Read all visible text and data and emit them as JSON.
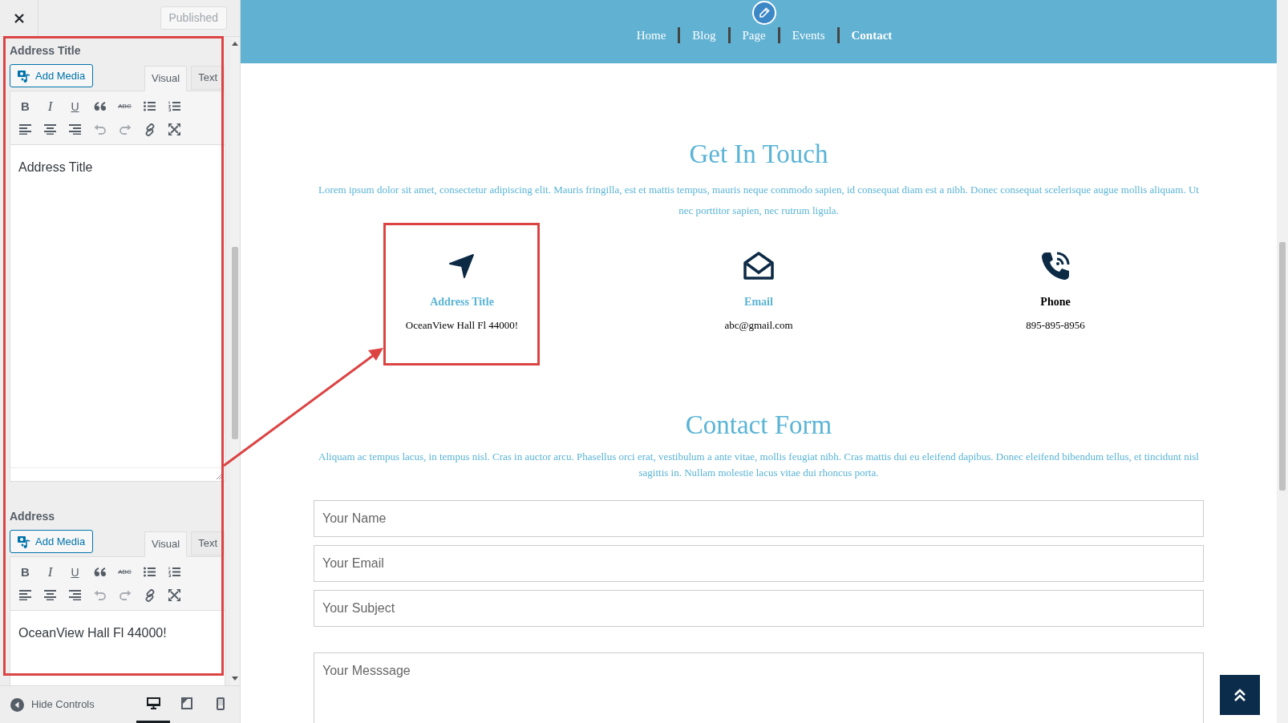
{
  "customizer": {
    "publish_button": "Published",
    "editors": [
      {
        "label": "Address Title",
        "add_media": "Add Media",
        "tabs": [
          {
            "label": "Visual",
            "selected": true
          },
          {
            "label": "Text",
            "selected": false
          }
        ],
        "content": "Address Title",
        "toolbar": [
          [
            {
              "kind": "bold",
              "label": "B",
              "disabled": false
            },
            {
              "kind": "italic",
              "label": "I",
              "disabled": false
            },
            {
              "kind": "underline",
              "label": "U",
              "disabled": false
            },
            {
              "kind": "quote",
              "disabled": false
            },
            {
              "kind": "strike",
              "label": "ABC",
              "disabled": false
            },
            {
              "kind": "bullets",
              "disabled": false
            },
            {
              "kind": "numbers",
              "disabled": false
            }
          ],
          [
            {
              "kind": "align-left",
              "disabled": false
            },
            {
              "kind": "align-center",
              "disabled": false
            },
            {
              "kind": "align-right",
              "disabled": false
            },
            {
              "kind": "undo",
              "disabled": true
            },
            {
              "kind": "redo",
              "disabled": true
            },
            {
              "kind": "link",
              "disabled": false
            },
            {
              "kind": "fullscreen",
              "disabled": false
            }
          ]
        ]
      },
      {
        "label": "Address",
        "add_media": "Add Media",
        "tabs": [
          {
            "label": "Visual",
            "selected": true
          },
          {
            "label": "Text",
            "selected": false
          }
        ],
        "content": "OceanView Hall Fl 44000!",
        "toolbar": [
          [
            {
              "kind": "bold",
              "label": "B",
              "disabled": false
            },
            {
              "kind": "italic",
              "label": "I",
              "disabled": false
            },
            {
              "kind": "underline",
              "label": "U",
              "disabled": false
            },
            {
              "kind": "quote",
              "disabled": false
            },
            {
              "kind": "strike",
              "label": "ABC",
              "disabled": false
            },
            {
              "kind": "bullets",
              "disabled": false
            },
            {
              "kind": "numbers",
              "disabled": false
            }
          ],
          [
            {
              "kind": "align-left",
              "disabled": false
            },
            {
              "kind": "align-center",
              "disabled": false
            },
            {
              "kind": "align-right",
              "disabled": false
            },
            {
              "kind": "undo",
              "disabled": true
            },
            {
              "kind": "redo",
              "disabled": true
            },
            {
              "kind": "link",
              "disabled": false
            },
            {
              "kind": "fullscreen",
              "disabled": false
            }
          ]
        ]
      }
    ],
    "footer": {
      "hide_controls": "Hide Controls",
      "devices": [
        {
          "kind": "desktop",
          "selected": true
        },
        {
          "kind": "tablet",
          "selected": false
        },
        {
          "kind": "mobile",
          "selected": false
        }
      ]
    }
  },
  "site": {
    "nav": [
      {
        "label": "Home",
        "selected": false
      },
      {
        "label": "Blog",
        "selected": false
      },
      {
        "label": "Page",
        "selected": false
      },
      {
        "label": "Events",
        "selected": false
      },
      {
        "label": "Contact",
        "selected": true
      }
    ],
    "touch": {
      "title": "Get In Touch",
      "text": "Lorem ipsum dolor sit amet, consectetur adipiscing elit. Mauris fringilla, est et mattis tempus, mauris neque commodo sapien, id consequat diam est a nibh. Donec consequat scelerisque augue mollis aliquam. Ut nec porttitor sapien, nec rutrum ligula.",
      "cards": [
        {
          "kind": "address",
          "title": "Address Title",
          "value": "OceanView Hall Fl 44000!",
          "color": "#5ab4d6"
        },
        {
          "kind": "email",
          "title": "Email",
          "value": "abc@gmail.com",
          "color": "#5ab4d6"
        },
        {
          "kind": "phone",
          "title": "Phone",
          "value": "895-895-8956",
          "color": "#000000"
        }
      ]
    },
    "form": {
      "title": "Contact Form",
      "text": "Aliquam ac tempus lacus, in tempus nisl. Cras in auctor arcu. Phasellus orci erat, vestibulum a ante vitae, mollis feugiat nibh. Cras mattis dui eu eleifend dapibus. Donec eleifend bibendum tellus, et tincidunt nisl sagittis in. Nullam molestie lacus vitae dui rhoncus porta.",
      "fields": [
        {
          "placeholder": "Your Name"
        },
        {
          "placeholder": "Your Email"
        },
        {
          "placeholder": "Your Subject"
        },
        {
          "placeholder": "Your Messsage",
          "kind": "textarea"
        }
      ]
    }
  }
}
